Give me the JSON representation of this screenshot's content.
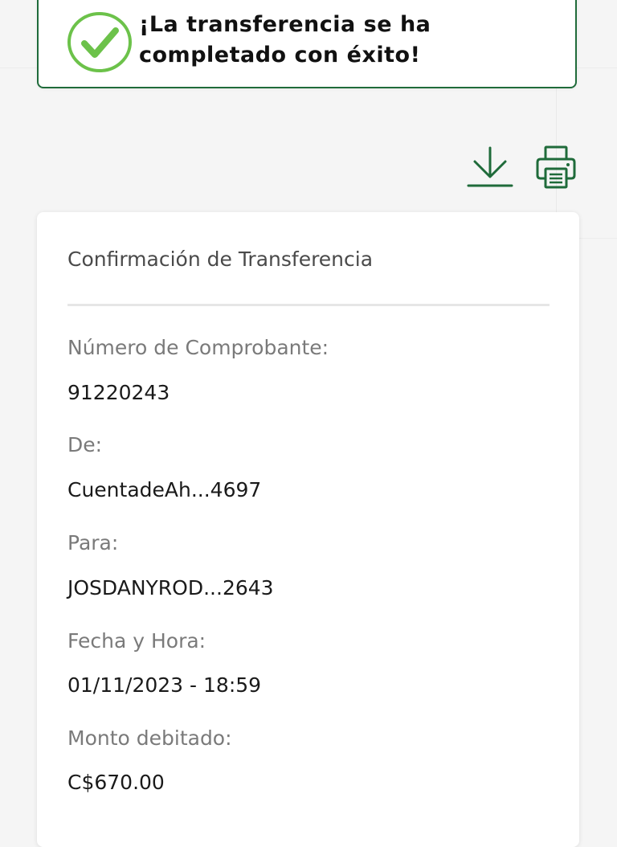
{
  "banner": {
    "message_line1": "¡La transferencia se ha",
    "message_line2": "completado con éxito!",
    "accent_color": "#1f6b3a",
    "check_color": "#6cc24a"
  },
  "actions": {
    "download_icon": "download-icon",
    "print_icon": "printer-icon"
  },
  "card": {
    "title": "Confirmación de Transferencia",
    "fields": [
      {
        "label": "Número de Comprobante:",
        "value": "91220243"
      },
      {
        "label": "De:",
        "value": "CuentadeAh...4697"
      },
      {
        "label": "Para:",
        "value": "JOSDANYROD...2643"
      },
      {
        "label": "Fecha y Hora:",
        "value": "01/11/2023 - 18:59"
      },
      {
        "label": "Monto debitado:",
        "value": "C$670.00"
      }
    ]
  }
}
